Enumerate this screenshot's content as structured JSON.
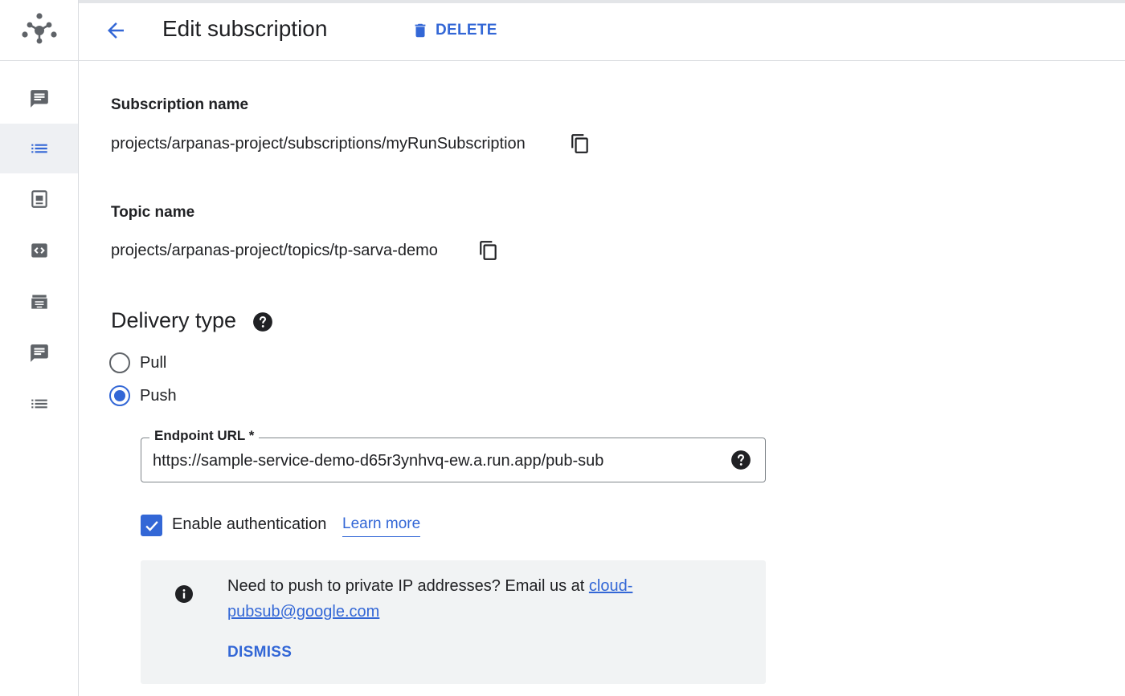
{
  "header": {
    "title": "Edit subscription",
    "delete_label": "DELETE"
  },
  "sidebar": {
    "items": [
      {
        "icon": "message-icon"
      },
      {
        "icon": "list-icon",
        "active": true
      },
      {
        "icon": "snapshot-icon"
      },
      {
        "icon": "code-icon"
      },
      {
        "icon": "schema-icon"
      },
      {
        "icon": "message-icon"
      },
      {
        "icon": "list-icon"
      }
    ]
  },
  "subscription": {
    "label": "Subscription name",
    "value": "projects/arpanas-project/subscriptions/myRunSubscription"
  },
  "topic": {
    "label": "Topic name",
    "value": "projects/arpanas-project/topics/tp-sarva-demo"
  },
  "delivery": {
    "title": "Delivery type",
    "options": [
      {
        "label": "Pull",
        "selected": false
      },
      {
        "label": "Push",
        "selected": true
      }
    ]
  },
  "endpoint": {
    "label": "Endpoint URL *",
    "value": "https://sample-service-demo-d65r3ynhvq-ew.a.run.app/pub-sub"
  },
  "auth": {
    "label": "Enable authentication",
    "checked": true,
    "learn_more": "Learn more"
  },
  "info": {
    "text": "Need to push to private IP addresses? Email us at ",
    "email_line1": "cloud-",
    "email_line2": "pubsub@google.com",
    "dismiss": "DISMISS"
  },
  "colors": {
    "accent": "#3367d6",
    "text": "#202124",
    "icon": "#5f6368",
    "panel": "#f1f3f4"
  }
}
